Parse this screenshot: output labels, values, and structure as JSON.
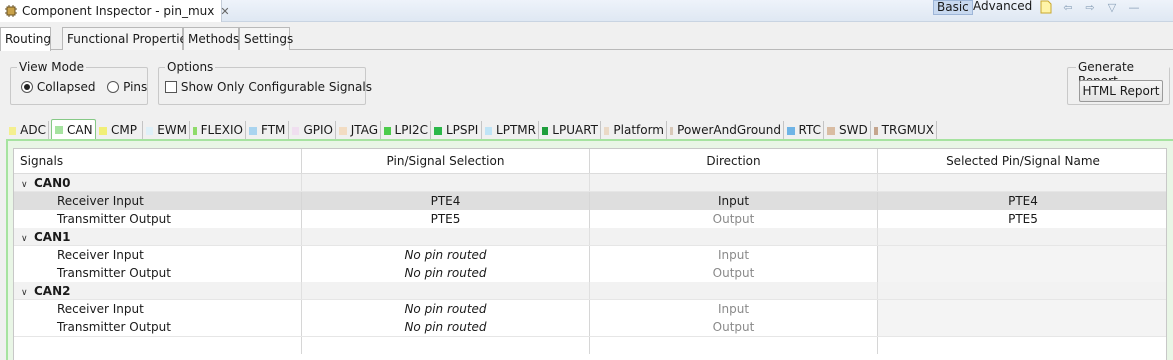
{
  "window": {
    "title": "Component Inspector - pin_mux",
    "mode_basic": "Basic",
    "mode_advanced": "Advanced"
  },
  "tabs": [
    "Routing",
    "Functional Properties",
    "Methods",
    "Settings"
  ],
  "view_mode": {
    "label": "View Mode",
    "option_collapsed": "Collapsed",
    "option_pins": "Pins",
    "selected": "Collapsed"
  },
  "options": {
    "label": "Options",
    "show_only_configurable": "Show Only Configurable Signals",
    "show_only_configurable_checked": false
  },
  "report": {
    "label": "Generate Report",
    "button": "HTML Report"
  },
  "peripheral_tabs": [
    {
      "label": "ADC",
      "color": "#f4ef8f"
    },
    {
      "label": "CAN",
      "color": "#a6e3a0"
    },
    {
      "label": "CMP",
      "color": "#f1ef77"
    },
    {
      "label": "EWM",
      "color": "#dff0f8"
    },
    {
      "label": "FLEXIO",
      "color": "#8fdb6a"
    },
    {
      "label": "FTM",
      "color": "#a9d4ef"
    },
    {
      "label": "GPIO",
      "color": "#f0dff0"
    },
    {
      "label": "JTAG",
      "color": "#f2dcc2"
    },
    {
      "label": "LPI2C",
      "color": "#4ccc4c"
    },
    {
      "label": "LPSPI",
      "color": "#2cb84a"
    },
    {
      "label": "LPTMR",
      "color": "#bfe4f6"
    },
    {
      "label": "LPUART",
      "color": "#1e9e3c"
    },
    {
      "label": "Platform",
      "color": "#ead9c6"
    },
    {
      "label": "PowerAndGround",
      "color": "#d8c8b8"
    },
    {
      "label": "RTC",
      "color": "#6fb4e6"
    },
    {
      "label": "SWD",
      "color": "#d9bca2"
    },
    {
      "label": "TRGMUX",
      "color": "#c4a58d"
    }
  ],
  "table": {
    "headers": [
      "Signals",
      "Pin/Signal Selection",
      "Direction",
      "Selected Pin/Signal Name"
    ],
    "groups": [
      {
        "name": "CAN0",
        "rows": [
          {
            "signal": "Receiver Input",
            "pin": "PTE4",
            "direction": "Input",
            "selected": "PTE4",
            "routed": true,
            "highlighted": true
          },
          {
            "signal": "Transmitter Output",
            "pin": "PTE5",
            "direction": "Output",
            "selected": "PTE5",
            "routed": true,
            "highlighted": false
          }
        ]
      },
      {
        "name": "CAN1",
        "rows": [
          {
            "signal": "Receiver Input",
            "pin": "No pin routed",
            "direction": "Input",
            "selected": "",
            "routed": false,
            "highlighted": false
          },
          {
            "signal": "Transmitter Output",
            "pin": "No pin routed",
            "direction": "Output",
            "selected": "",
            "routed": false,
            "highlighted": false
          }
        ]
      },
      {
        "name": "CAN2",
        "rows": [
          {
            "signal": "Receiver Input",
            "pin": "No pin routed",
            "direction": "Input",
            "selected": "",
            "routed": false,
            "highlighted": false
          },
          {
            "signal": "Transmitter Output",
            "pin": "No pin routed",
            "direction": "Output",
            "selected": "",
            "routed": false,
            "highlighted": false
          }
        ]
      }
    ]
  }
}
